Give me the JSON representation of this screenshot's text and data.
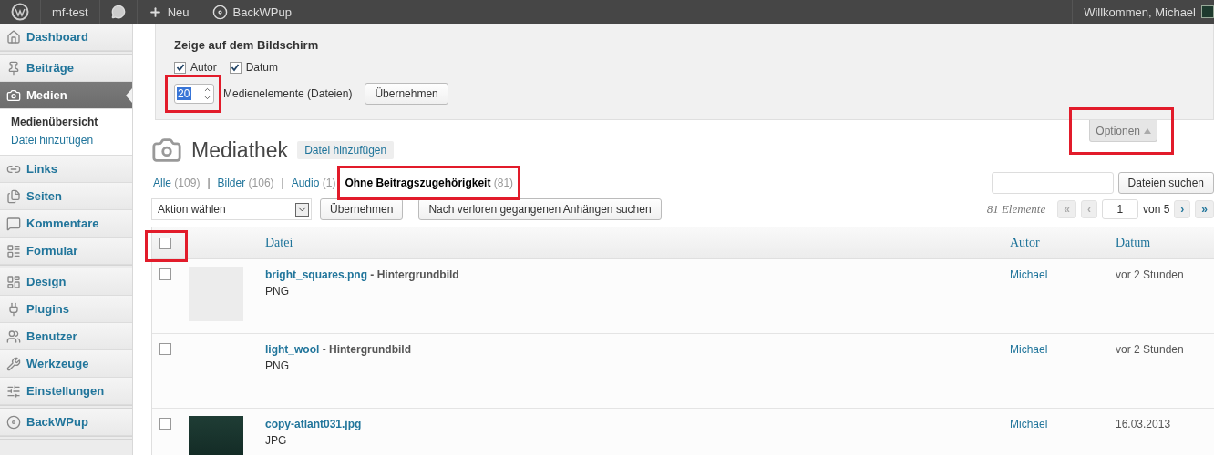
{
  "admin_bar": {
    "site": "mf-test",
    "new": "Neu",
    "plugin": "BackWPup",
    "greeting": "Willkommen, Michael"
  },
  "sidebar": {
    "groups": [
      [
        {
          "label": "Dashboard",
          "selected": false
        }
      ],
      [
        {
          "label": "Beiträge",
          "selected": false
        },
        {
          "label": "Medien",
          "selected": true,
          "children": [
            {
              "label": "Medienübersicht",
              "selected": true
            },
            {
              "label": "Datei hinzufügen",
              "selected": false
            }
          ]
        },
        {
          "label": "Links",
          "selected": false
        },
        {
          "label": "Seiten",
          "selected": false
        },
        {
          "label": "Kommentare",
          "selected": false
        },
        {
          "label": "Formular",
          "selected": false
        }
      ],
      [
        {
          "label": "Design",
          "selected": false
        },
        {
          "label": "Plugins",
          "selected": false
        },
        {
          "label": "Benutzer",
          "selected": false
        },
        {
          "label": "Werkzeuge",
          "selected": false
        },
        {
          "label": "Einstellungen",
          "selected": false
        }
      ],
      [
        {
          "label": "BackWPup",
          "selected": false
        }
      ]
    ]
  },
  "screen_options": {
    "title": "Zeige auf dem Bildschirm",
    "columns": [
      {
        "label": "Autor",
        "checked": true
      },
      {
        "label": "Datum",
        "checked": true
      }
    ],
    "per_page": {
      "value": "20",
      "highlighted": true
    },
    "per_page_label": "Medienelemente (Dateien)",
    "apply": "Übernehmen"
  },
  "options_tab": {
    "label": "Optionen",
    "expanded": true,
    "highlighted": true
  },
  "page": {
    "title": "Mediathek",
    "add_button": "Datei hinzufügen"
  },
  "filters": [
    {
      "label": "Alle",
      "count": "(109)",
      "divider": "|",
      "selected": false
    },
    {
      "label": "Bilder",
      "count": "(106)",
      "divider": "|",
      "selected": false
    },
    {
      "label": "Audio",
      "count": "(1)",
      "selected": false
    },
    {
      "label": "Ohne Beitragszugehörigkeit",
      "count": "(81)",
      "selected": true,
      "highlighted": true
    }
  ],
  "search": {
    "button": "Dateien suchen"
  },
  "bulk": {
    "action": "Aktion wählen",
    "apply": "Übernehmen",
    "detach": "Nach verloren gegangenen Anhängen suchen"
  },
  "pagination": {
    "count": "81 Elemente",
    "first": "«",
    "prev": "‹",
    "page": "1",
    "of": "von 5",
    "next": "›",
    "last": "»"
  },
  "table": {
    "select_all": {
      "checked": false,
      "highlighted": true
    },
    "columns": [
      "Datei",
      "Autor",
      "Datum"
    ],
    "rows": [
      {
        "file": "bright_squares.png",
        "title": "- Hintergrundbild",
        "type": "PNG",
        "author": "Michael",
        "date": "vor 2 Stunden",
        "checked": false,
        "kind": "light"
      },
      {
        "file": "light_wool",
        "title": "- Hintergrundbild",
        "type": "PNG",
        "author": "Michael",
        "date": "vor 2 Stunden",
        "checked": false,
        "kind": "blank"
      },
      {
        "file": "copy-atlant031.jpg",
        "type": "JPG",
        "author": "Michael",
        "date": "16.03.2013",
        "checked": false,
        "kind": "dark"
      }
    ]
  }
}
